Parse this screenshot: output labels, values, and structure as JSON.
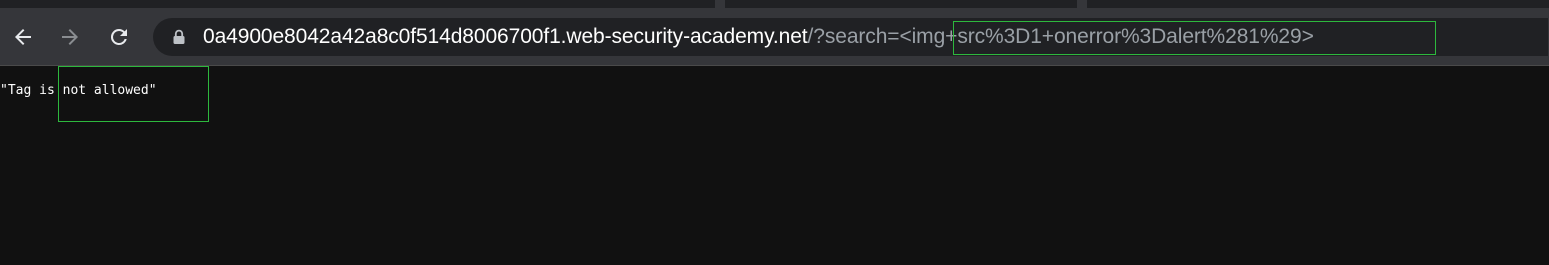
{
  "browser": {
    "url_host": "0a4900e8042a42a8c0f514d8006700f1.web-security-academy.net",
    "url_path": "/?search=<img+src%3D1+onerror%3Dalert%281%29>",
    "icons": {
      "back": "arrow-left-icon",
      "forward": "arrow-right-icon",
      "reload": "reload-icon",
      "lock": "lock-icon"
    }
  },
  "page": {
    "message": "\"Tag is not allowed\""
  },
  "colors": {
    "highlight": "#2db83d",
    "toolbar": "#35363a",
    "omnibox": "#202124",
    "page_bg": "#111111"
  }
}
